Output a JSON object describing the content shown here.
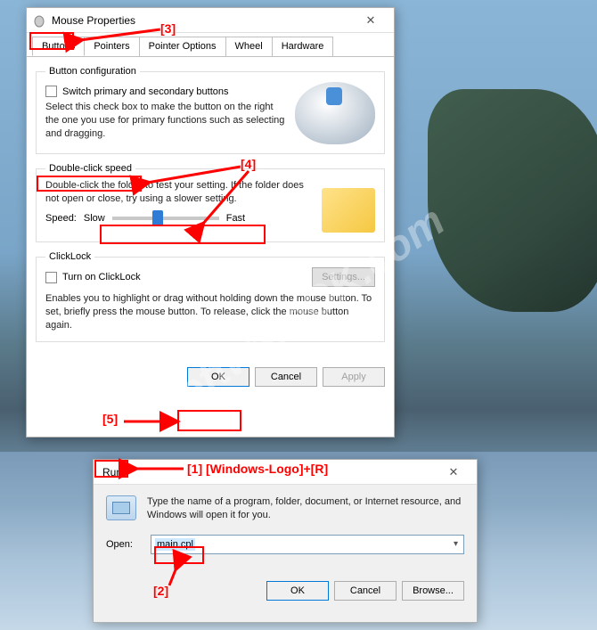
{
  "watermark": "SoftwareOK.com",
  "mouse_dialog": {
    "title": "Mouse Properties",
    "tabs": [
      "Buttons",
      "Pointers",
      "Pointer Options",
      "Wheel",
      "Hardware"
    ],
    "active_tab": "Buttons",
    "button_config": {
      "legend": "Button configuration",
      "checkbox_label": "Switch primary and secondary buttons",
      "desc": "Select this check box to make the button on the right the one you use for primary functions such as selecting and dragging."
    },
    "dblclick": {
      "legend": "Double-click speed",
      "desc": "Double-click the folder to test your setting. If the folder does not open or close, try using a slower setting.",
      "speed_label": "Speed:",
      "slow": "Slow",
      "fast": "Fast"
    },
    "clicklock": {
      "legend": "ClickLock",
      "checkbox_label": "Turn on ClickLock",
      "settings_btn": "Settings...",
      "desc": "Enables you to highlight or drag without holding down the mouse button. To set, briefly press the mouse button. To release, click the mouse button again."
    },
    "buttons": {
      "ok": "OK",
      "cancel": "Cancel",
      "apply": "Apply"
    }
  },
  "run_dialog": {
    "title": "Run",
    "desc": "Type the name of a program, folder, document, or Internet resource, and Windows will open it for you.",
    "open_label": "Open:",
    "open_value": "main.cpl",
    "buttons": {
      "ok": "OK",
      "cancel": "Cancel",
      "browse": "Browse..."
    }
  },
  "annotations": {
    "1": "[1]  [Windows-Logo]+[R]",
    "2": "[2]",
    "3": "[3]",
    "4": "[4]",
    "5": "[5]"
  }
}
